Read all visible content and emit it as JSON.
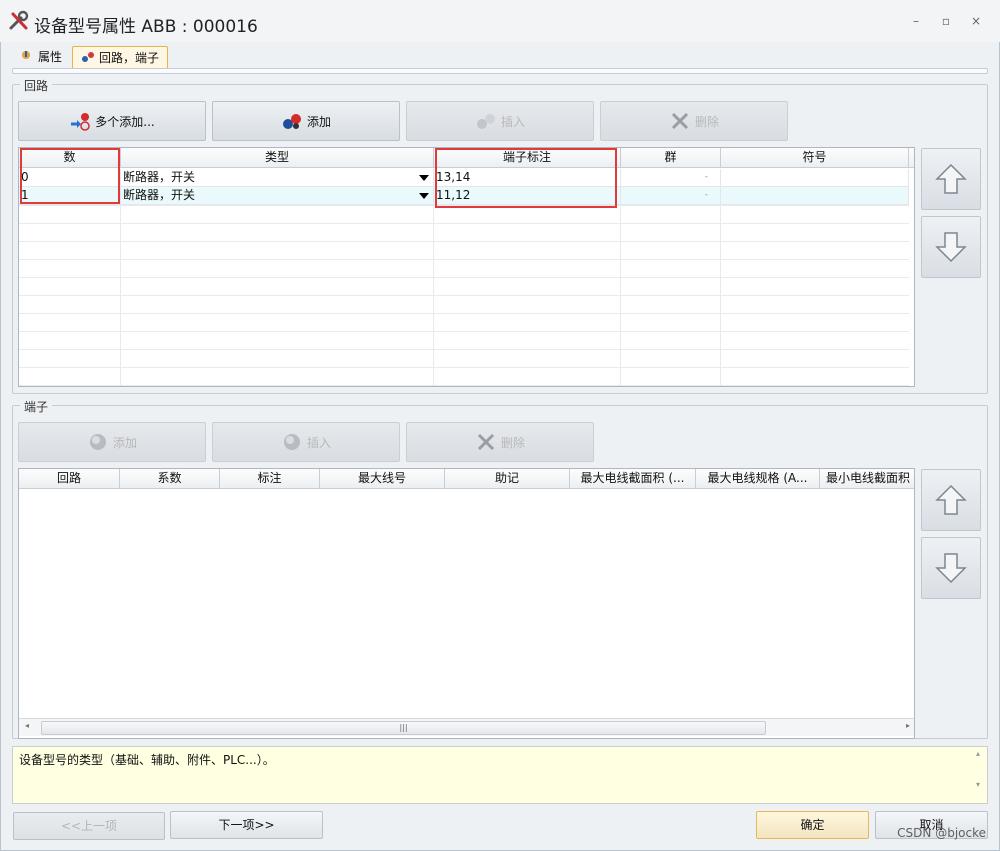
{
  "window": {
    "title": "设备型号属性 ABB : 000016",
    "minimize_glyph": "–",
    "maximize_glyph": "▫",
    "close_glyph": "×"
  },
  "tabs": [
    {
      "label": "属性",
      "active": false
    },
    {
      "label": "回路，端子",
      "active": true
    }
  ],
  "circuit_group": {
    "label": "回路",
    "buttons": {
      "multi_add": "多个添加...",
      "add": "添加",
      "insert": "插入",
      "delete": "删除"
    },
    "columns": [
      "数",
      "类型",
      "端子标注",
      "群",
      "符号"
    ],
    "rows": [
      {
        "num": "0",
        "type": "断路器，开关",
        "terminal": "13,14",
        "group": "-",
        "symbol": ""
      },
      {
        "num": "1",
        "type": "断路器，开关",
        "terminal": "11,12",
        "group": "-",
        "symbol": ""
      }
    ]
  },
  "terminal_group": {
    "label": "端子",
    "buttons": {
      "add": "添加",
      "insert": "插入",
      "delete": "删除"
    },
    "columns": [
      "回路",
      "系数",
      "标注",
      "最大线号",
      "助记",
      "最大电线截面积 (...",
      "最大电线规格 (A...",
      "最小电线截面积"
    ],
    "scroll_thumb_glyph": "|||"
  },
  "description": "设备型号的类型（基础、辅助、附件、PLC...）。",
  "footer": {
    "prev": "<<上一项",
    "next": "下一项>>",
    "ok": "确定",
    "cancel": "取消"
  },
  "watermark": "CSDN @bjocke",
  "colors": {
    "highlight_box": "#e03a3a",
    "active_tab_border": "#e8b24f",
    "description_bg": "#ffffe2"
  }
}
